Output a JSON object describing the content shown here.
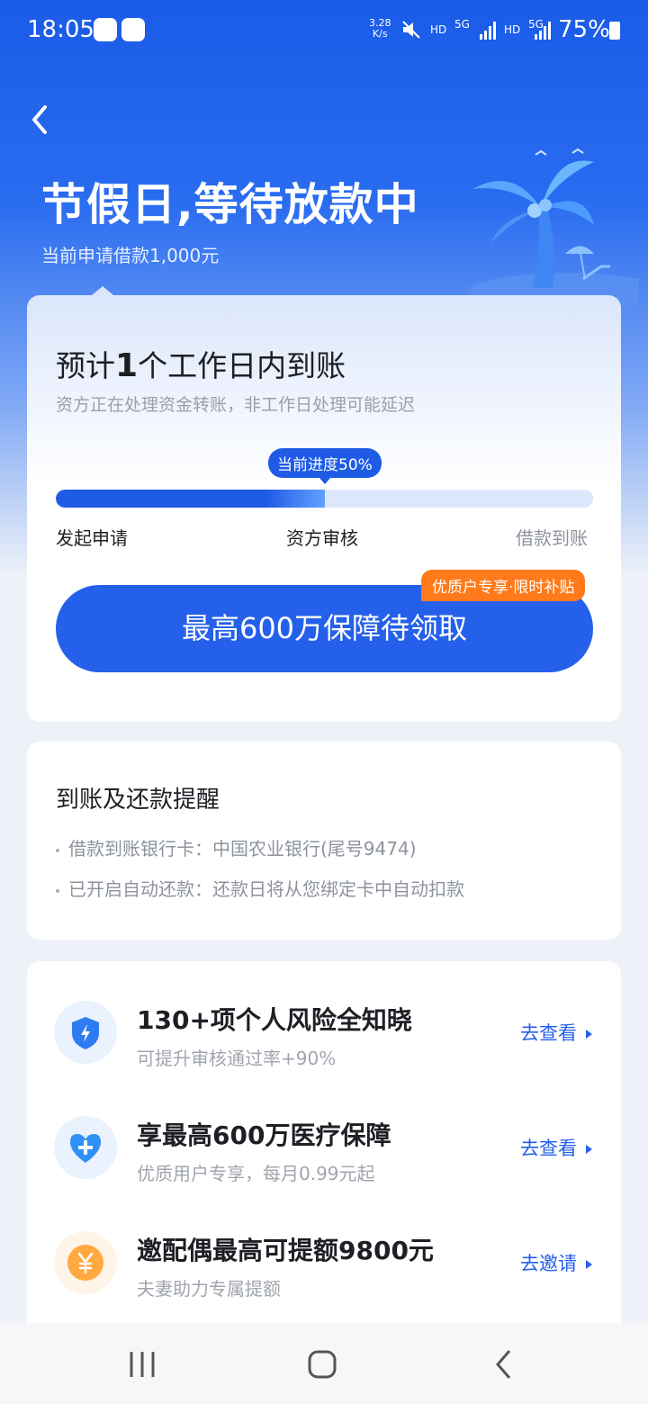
{
  "status_bar": {
    "time": "18:05",
    "net_speed_value": "3.28",
    "net_speed_unit": "K/s",
    "hd1": "HD",
    "net1": "5G",
    "hd2": "HD",
    "net2": "5G",
    "battery": "75%"
  },
  "header": {
    "title": "节假日,等待放款中",
    "subtitle": "当前申请借款1,000元"
  },
  "progress_card": {
    "eta_prefix": "预计",
    "eta_number": "1",
    "eta_suffix": "个工作日内到账",
    "note": "资方正在处理资金转账，非工作日处理可能延迟",
    "progress_label": "当前进度50%",
    "progress_value": 0.5,
    "steps": [
      "发起申请",
      "资方审核",
      "借款到账"
    ],
    "cta_label": "最高600万保障待领取",
    "cta_tag": "优质户专享·限时补贴"
  },
  "reminder_card": {
    "title": "到账及还款提醒",
    "lines": [
      "借款到账银行卡：中国农业银行(尾号9474)",
      "已开启自动还款：还款日将从您绑定卡中自动扣款"
    ]
  },
  "services": [
    {
      "icon": "shield-bolt-icon",
      "title": "130+项个人风险全知晓",
      "subtitle": "可提升审核通过率+90%",
      "action": "去查看"
    },
    {
      "icon": "heart-plus-icon",
      "title": "享最高600万医疗保障",
      "subtitle": "优质用户专享，每月0.99元起",
      "action": "去查看"
    },
    {
      "icon": "yen-coin-icon",
      "title": "邀配偶最高可提额9800元",
      "subtitle": "夫妻助力专属提额",
      "action": "去邀请"
    }
  ],
  "colors": {
    "primary": "#2560EA",
    "header_blue": "#1A5BE8",
    "tag_orange": "#FF7A1A",
    "coin_orange": "#FFA940"
  }
}
